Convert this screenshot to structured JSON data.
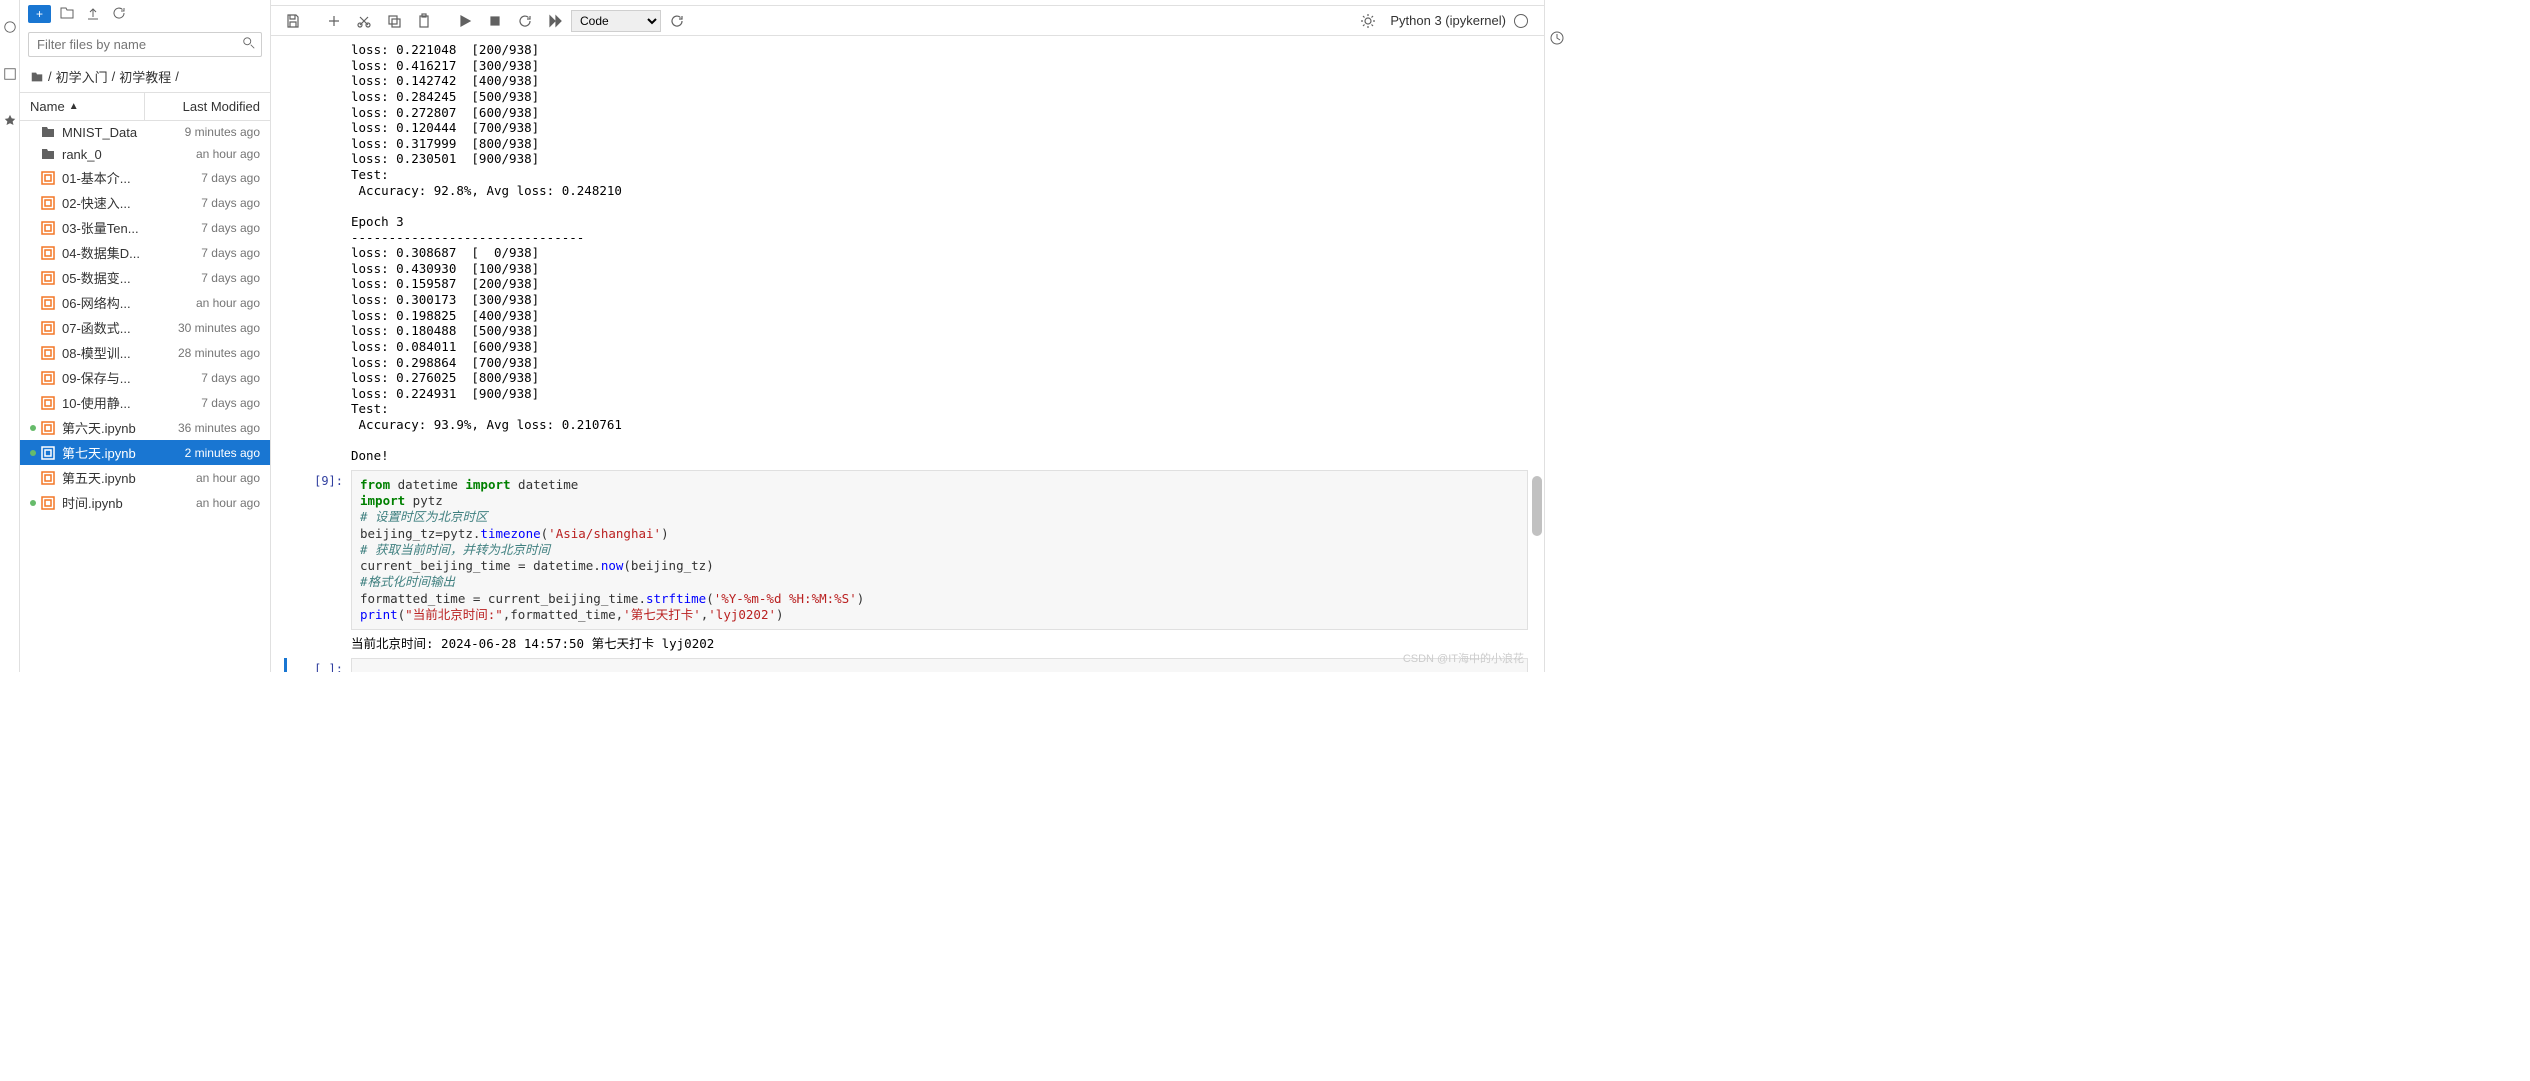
{
  "filter_placeholder": "Filter files by name",
  "breadcrumb": [
    "/",
    "初学入门",
    "/",
    "初学教程",
    "/"
  ],
  "columns": {
    "name": "Name",
    "modified": "Last Modified"
  },
  "files": [
    {
      "icon": "folder",
      "name": "MNIST_Data",
      "modified": "9 minutes ago",
      "running": false
    },
    {
      "icon": "folder",
      "name": "rank_0",
      "modified": "an hour ago",
      "running": false
    },
    {
      "icon": "nb",
      "name": "01-基本介...",
      "modified": "7 days ago",
      "running": false
    },
    {
      "icon": "nb",
      "name": "02-快速入...",
      "modified": "7 days ago",
      "running": false
    },
    {
      "icon": "nb",
      "name": "03-张量Ten...",
      "modified": "7 days ago",
      "running": false
    },
    {
      "icon": "nb",
      "name": "04-数据集D...",
      "modified": "7 days ago",
      "running": false
    },
    {
      "icon": "nb",
      "name": "05-数据变...",
      "modified": "7 days ago",
      "running": false
    },
    {
      "icon": "nb",
      "name": "06-网络构...",
      "modified": "an hour ago",
      "running": false
    },
    {
      "icon": "nb",
      "name": "07-函数式...",
      "modified": "30 minutes ago",
      "running": false
    },
    {
      "icon": "nb",
      "name": "08-模型训...",
      "modified": "28 minutes ago",
      "running": false
    },
    {
      "icon": "nb",
      "name": "09-保存与...",
      "modified": "7 days ago",
      "running": false
    },
    {
      "icon": "nb",
      "name": "10-使用静...",
      "modified": "7 days ago",
      "running": false
    },
    {
      "icon": "nb",
      "name": "第六天.ipynb",
      "modified": "36 minutes ago",
      "running": true
    },
    {
      "icon": "nb",
      "name": "第七天.ipynb",
      "modified": "2 minutes ago",
      "running": true,
      "selected": true
    },
    {
      "icon": "nb",
      "name": "第五天.ipynb",
      "modified": "an hour ago",
      "running": false
    },
    {
      "icon": "nb",
      "name": "时间.ipynb",
      "modified": "an hour ago",
      "running": true
    }
  ],
  "cell_type_dropdown": "Code",
  "kernel_name": "Python 3 (ipykernel)",
  "output_text": "loss: 0.221048  [200/938]\nloss: 0.416217  [300/938]\nloss: 0.142742  [400/938]\nloss: 0.284245  [500/938]\nloss: 0.272807  [600/938]\nloss: 0.120444  [700/938]\nloss: 0.317999  [800/938]\nloss: 0.230501  [900/938]\nTest:\n Accuracy: 92.8%, Avg loss: 0.248210\n\nEpoch 3\n-------------------------------\nloss: 0.308687  [  0/938]\nloss: 0.430930  [100/938]\nloss: 0.159587  [200/938]\nloss: 0.300173  [300/938]\nloss: 0.198825  [400/938]\nloss: 0.180488  [500/938]\nloss: 0.084011  [600/938]\nloss: 0.298864  [700/938]\nloss: 0.276025  [800/938]\nloss: 0.224931  [900/938]\nTest:\n Accuracy: 93.9%, Avg loss: 0.210761\n\nDone!",
  "code_cell_prompt": "[9]:",
  "empty_cell_prompt": "[ ]:",
  "code_lines": {
    "l1a": "from",
    "l1b": " datetime ",
    "l1c": "import",
    "l1d": " datetime",
    "l2a": "import",
    "l2b": " pytz",
    "l3": "#  设置时区为北京时区",
    "l4a": "beijing_tz=pytz.",
    "l4b": "timezone",
    "l4c": "(",
    "l4d": "'Asia/shanghai'",
    "l4e": ")",
    "l5": "#  获取当前时间，并转为北京时间",
    "l6a": "current_beijing_time = datetime.",
    "l6b": "now",
    "l6c": "(beijing_tz)",
    "l7": "#格式化时间输出",
    "l8a": "formatted_time = current_beijing_time.",
    "l8b": "strftime",
    "l8c": "(",
    "l8d": "'%Y-%m-%d %H:%M:%S'",
    "l8e": ")",
    "l9a": "print",
    "l9b": "(",
    "l9c": "\"当前北京时间:\"",
    "l9d": ",formatted_time,",
    "l9e": "'第七天打卡'",
    "l9f": ",",
    "l9g": "'lyj0202'",
    "l9h": ")"
  },
  "code_output": "当前北京时间: 2024-06-28 14:57:50 第七天打卡 lyj0202",
  "watermark": "CSDN @IT海中的小浪花"
}
